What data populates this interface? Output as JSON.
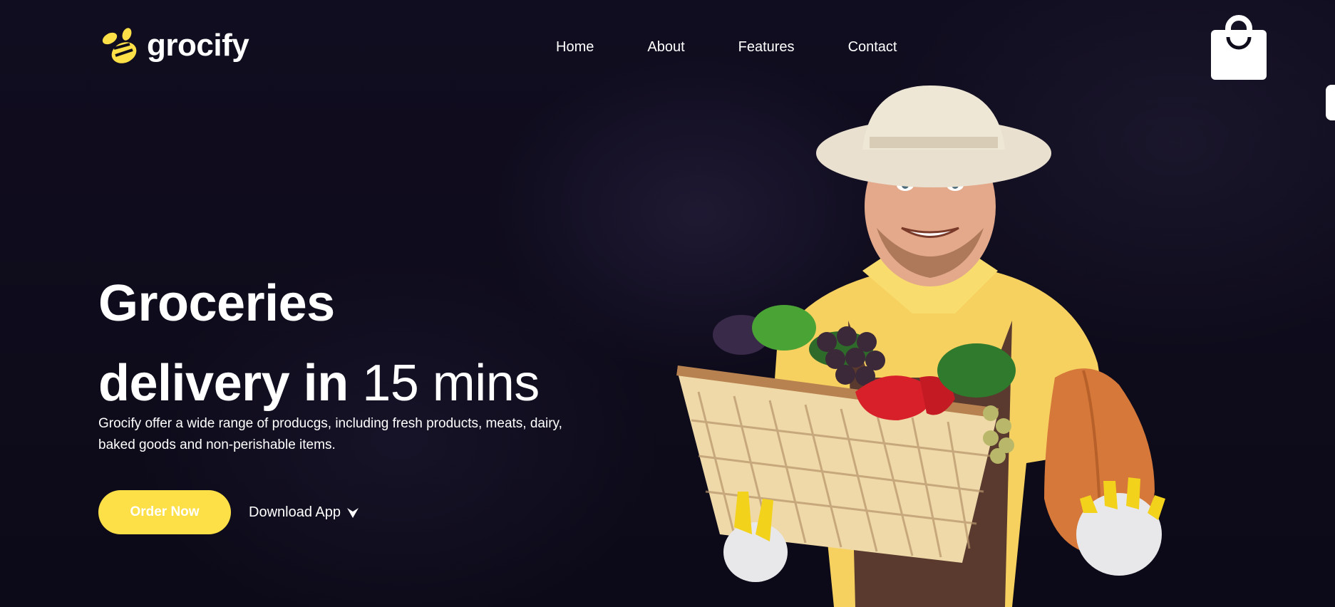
{
  "brand": {
    "name": "grocify",
    "accent": "#fde047"
  },
  "nav": {
    "items": [
      {
        "label": "Home"
      },
      {
        "label": "About"
      },
      {
        "label": "Features"
      },
      {
        "label": "Contact"
      }
    ]
  },
  "header": {
    "cart_icon": "shopping-bag-icon"
  },
  "hero": {
    "title_line1": "Groceries",
    "title_line2_bold": "delivery in",
    "title_line2_light": "15 mins",
    "description": "Grocify offer a wide range of producgs, including fresh products, meats, dairy, baked goods and non-perishable items.",
    "order_button": "Order Now",
    "download_label": "Download App",
    "download_icon": "caret-down-icon"
  },
  "colors": {
    "background": "#0e0b1b",
    "button": "#fde047",
    "text": "#ffffff"
  }
}
